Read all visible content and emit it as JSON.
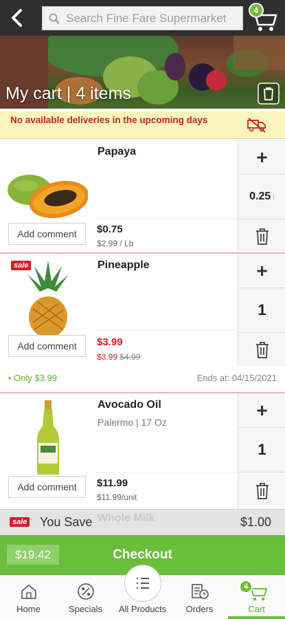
{
  "header": {
    "search_placeholder": "Search Fine Fare Supermarket",
    "cart_count": "4"
  },
  "hero": {
    "title": "My cart | 4 items"
  },
  "notice": {
    "text": "No available deliveries in the upcoming days"
  },
  "items": [
    {
      "name": "Papaya",
      "price": "$0.75",
      "unit_price": "$2.99 / Lb",
      "quantity": "0.25",
      "comment_label": "Add comment"
    },
    {
      "name": "Pineapple",
      "sale_badge": "sale",
      "price": "$3.99",
      "unit_price_sale": "$3.99",
      "unit_price_old": "$4.99",
      "quantity": "1",
      "comment_label": "Add comment",
      "promo": "• Only $3.99",
      "ends": "Ends at: 04/15/2021"
    },
    {
      "name": "Avocado Oil",
      "subtitle": "Palermo | 17 Oz",
      "price": "$11.99",
      "unit_price": "$11.99/unit",
      "quantity": "1",
      "comment_label": "Add comment"
    }
  ],
  "savings": {
    "badge": "sale",
    "label": "You Save",
    "ghost_item": "Whole Milk",
    "amount": "$1.00"
  },
  "checkout": {
    "total": "$19.42",
    "label": "Checkout"
  },
  "nav": {
    "items": [
      {
        "label": "Home",
        "icon": "home-icon"
      },
      {
        "label": "Specials",
        "icon": "percent-icon"
      },
      {
        "label": "All Products",
        "icon": "list-icon"
      },
      {
        "label": "Orders",
        "icon": "orders-icon"
      },
      {
        "label": "Cart",
        "icon": "cart-icon",
        "active": true
      }
    ],
    "cart_count": "4"
  },
  "colors": {
    "accent_green": "#6cbf3a",
    "sale_red": "#d71b26",
    "notice_bg": "#fcf5c0",
    "topbar": "#2f2f2f"
  }
}
